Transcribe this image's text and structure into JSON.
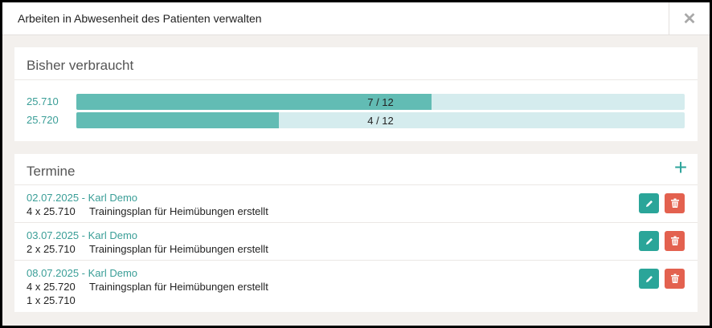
{
  "modal": {
    "title": "Arbeiten in Abwesenheit des Patienten verwalten",
    "close_symbol": "✕"
  },
  "usage": {
    "title": "Bisher verbraucht",
    "rows": [
      {
        "code": "25.710",
        "label": "7 / 12",
        "used": 7,
        "total": 12
      },
      {
        "code": "25.720",
        "label": "4 / 12",
        "used": 4,
        "total": 12
      }
    ]
  },
  "appointments": {
    "title": "Termine",
    "add_symbol": "+",
    "items": [
      {
        "header": "02.07.2025 - Karl Demo",
        "lines": [
          {
            "qty": "4 x 25.710",
            "desc": "Trainingsplan für Heimübungen erstellt"
          }
        ]
      },
      {
        "header": "03.07.2025 - Karl Demo",
        "lines": [
          {
            "qty": "2 x 25.710",
            "desc": "Trainingsplan für Heimübungen erstellt"
          }
        ]
      },
      {
        "header": "08.07.2025 - Karl Demo",
        "lines": [
          {
            "qty": "4 x 25.720",
            "desc": "Trainingsplan für Heimübungen erstellt"
          },
          {
            "qty": "1 x 25.710",
            "desc": ""
          }
        ]
      }
    ]
  },
  "icons": {
    "edit": "pencil-icon",
    "delete": "trash-icon"
  },
  "colors": {
    "accent": "#2aa599",
    "bar_fill": "#62bcb4",
    "bar_track": "#d5ecee",
    "delete": "#e3614f",
    "link": "#3a9e97"
  }
}
